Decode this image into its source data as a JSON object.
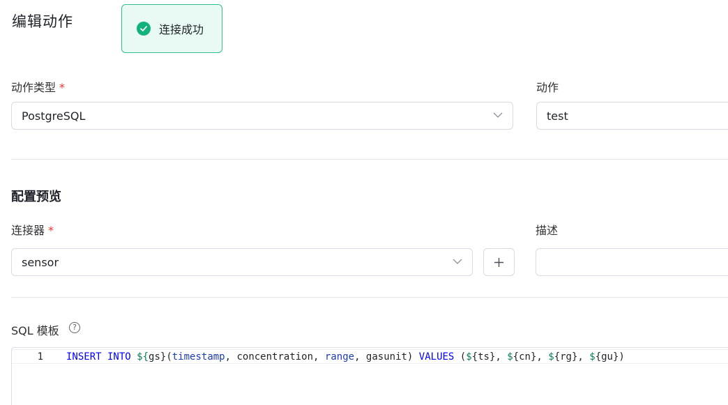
{
  "page": {
    "title": "编辑动作"
  },
  "toast": {
    "message": "连接成功",
    "color": "#11b37b"
  },
  "form": {
    "action_type": {
      "label": "动作类型",
      "required_mark": "*",
      "value": "PostgreSQL"
    },
    "action": {
      "label": "动作",
      "value": "test"
    },
    "config_section": {
      "title": "配置预览"
    },
    "connector": {
      "label": "连接器",
      "required_mark": "*",
      "value": "sensor"
    },
    "description": {
      "label": "描述",
      "value": ""
    },
    "sql_template": {
      "label": "SQL 模板",
      "help_glyph": "?",
      "line_number": "1",
      "tokens": [
        {
          "t": "INSERT INTO",
          "k": "kw"
        },
        {
          "t": " ",
          "k": ""
        },
        {
          "t": "${",
          "k": "var"
        },
        {
          "t": "gs}",
          "k": ""
        },
        {
          "t": "(",
          "k": ""
        },
        {
          "t": "timestamp",
          "k": "fn"
        },
        {
          "t": ", concentration, ",
          "k": ""
        },
        {
          "t": "range",
          "k": "fn"
        },
        {
          "t": ", gasunit) ",
          "k": ""
        },
        {
          "t": "VALUES",
          "k": "kw"
        },
        {
          "t": " (",
          "k": ""
        },
        {
          "t": "$",
          "k": "var"
        },
        {
          "t": "{ts}, ",
          "k": ""
        },
        {
          "t": "$",
          "k": "var"
        },
        {
          "t": "{cn}, ",
          "k": ""
        },
        {
          "t": "$",
          "k": "var"
        },
        {
          "t": "{rg}, ",
          "k": ""
        },
        {
          "t": "$",
          "k": "var"
        },
        {
          "t": "{gu})",
          "k": ""
        }
      ]
    }
  },
  "icons": {
    "toast": "check-circle-icon",
    "select_arrow": "chevron-down-icon",
    "add": "plus-icon",
    "help": "question-circle-icon"
  }
}
